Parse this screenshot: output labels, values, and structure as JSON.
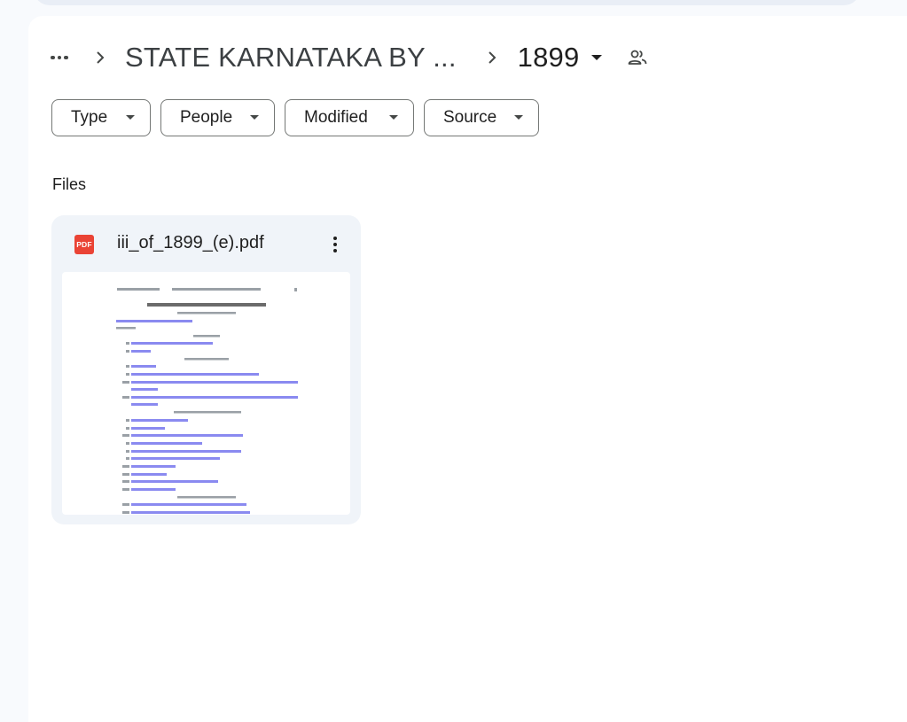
{
  "breadcrumb": {
    "more_icon": "more-horiz-icon",
    "parent": "STATE KARNATAKA BY ...",
    "current": "1899",
    "shared_icon": "people-icon"
  },
  "filters": [
    {
      "label": "Type"
    },
    {
      "label": "People"
    },
    {
      "label": "Modified"
    },
    {
      "label": "Source"
    }
  ],
  "sections": {
    "files_label": "Files"
  },
  "files": [
    {
      "name": "iii_of_1899_(e).pdf",
      "icon": "pdf-icon",
      "icon_text": "PDF",
      "icon_color": "#ea4335"
    }
  ],
  "colors": {
    "background": "#f8fafd",
    "card": "#f0f4f9",
    "link": "#3c3ce0"
  }
}
